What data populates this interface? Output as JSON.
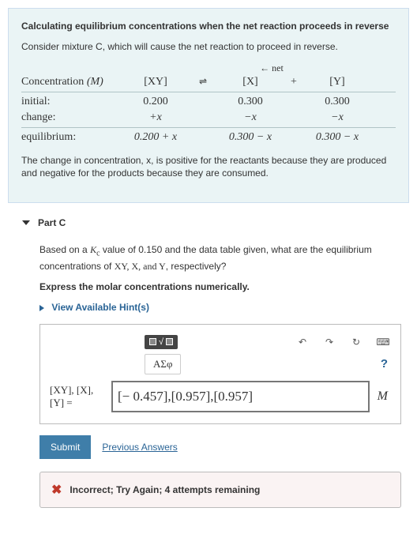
{
  "info": {
    "title": "Calculating equilibrium concentrations when the net reaction proceeds in reverse",
    "intro": "Consider mixture C, which will cause the net reaction to proceed in reverse.",
    "net_label": "net",
    "headers": {
      "conc": "Concentration",
      "unit": "(M)",
      "xy": "[XY]",
      "eq": "⇌",
      "x": "[X]",
      "plus": "+",
      "y": "[Y]"
    },
    "rows": {
      "initial": {
        "label": "initial:",
        "xy": "0.200",
        "x": "0.300",
        "y": "0.300"
      },
      "change": {
        "label": "change:",
        "xy": "+x",
        "x": "−x",
        "y": "−x"
      },
      "equilibrium": {
        "label": "equilibrium:",
        "xy": "0.200 + x",
        "x": "0.300 − x",
        "y": "0.300 − x"
      }
    },
    "after_note": "The change in concentration, x, is positive for the reactants because they are produced and negative for the products because they are consumed."
  },
  "partc": {
    "label": "Part C",
    "question_pre": "Based on a ",
    "kc": "K",
    "kc_sub": "c",
    "question_mid": " value of 0.150 and the data table given, what are the equilibrium concentrations of ",
    "species": "XY, X, and Y",
    "question_end": ", respectively?",
    "instruction": "Express the molar concentrations numerically.",
    "hints_label": "View Available Hint(s)",
    "greek_label": "ΑΣφ",
    "help_label": "?",
    "lhs_line1": "[XY], [X],",
    "lhs_line2": "[Y] =",
    "answer_value": "[− 0.457],[0.957],[0.957]",
    "unit": "M",
    "submit_label": "Submit",
    "prev_answers_label": "Previous Answers",
    "feedback": "Incorrect; Try Again; 4 attempts remaining"
  },
  "icons": {
    "sqrt": "√",
    "undo": "↶",
    "redo": "↷",
    "reset": "↻",
    "keyboard": "⌨",
    "close_x": "✖"
  }
}
